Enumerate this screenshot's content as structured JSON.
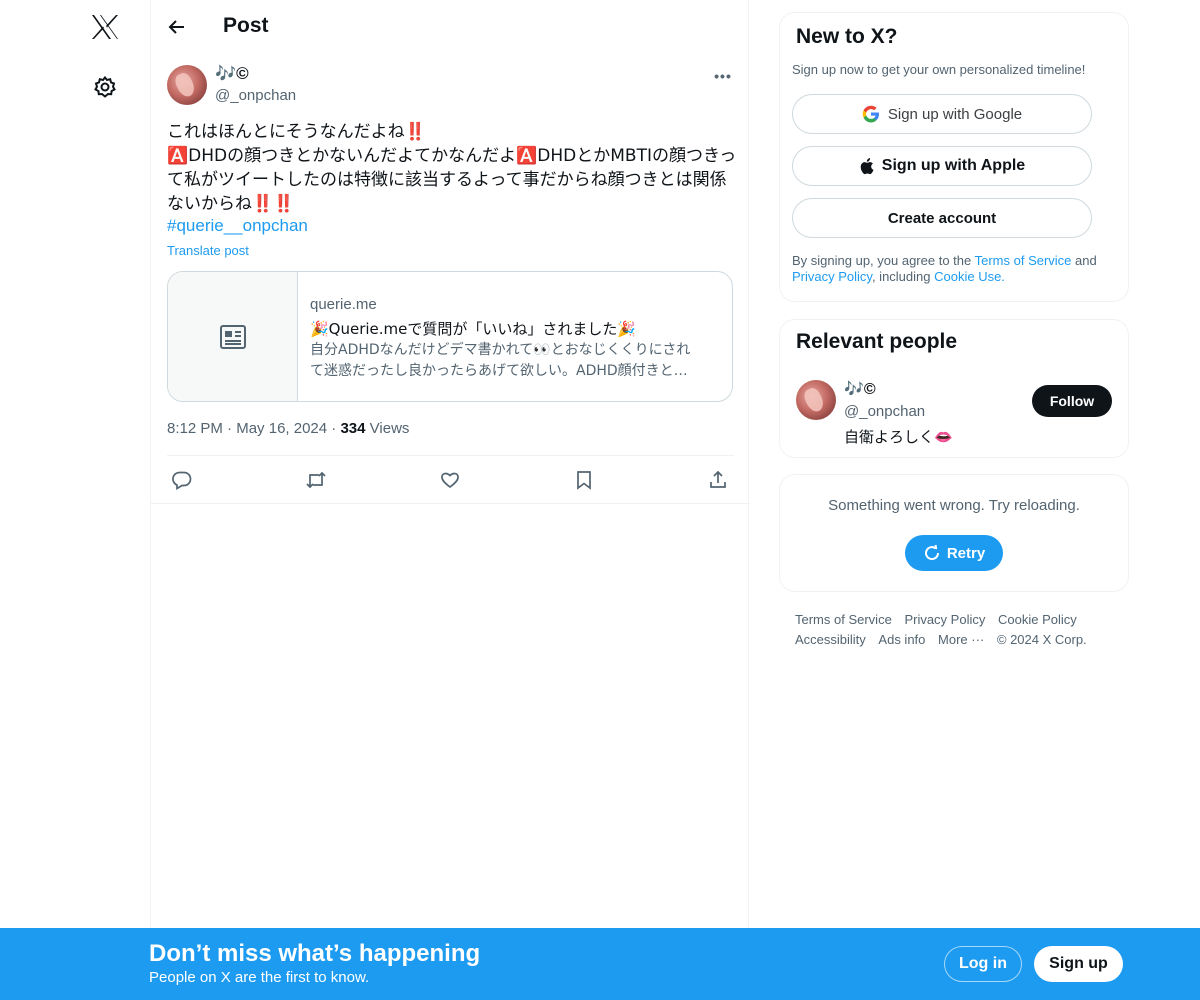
{
  "nav": {
    "logo_icon": "x-logo-icon",
    "settings_icon": "gear-icon"
  },
  "header": {
    "title": "Post",
    "back_icon": "arrow-left-icon"
  },
  "post": {
    "author_name": "🎶©",
    "author_handle": "@_onpchan",
    "text_lines": [
      "これはほんとにそうなんだよね‼️",
      "🅰️DHDの顔つきとかないんだよてかなんだよ🅰️DHDとかMBTIの顔つきっ",
      "て私がツイートしたのは特徴に該当するよって事だからね顔つきとは関係",
      "ないからね‼️‼️"
    ],
    "hashtag": "#querie__onpchan",
    "translate": "Translate post",
    "card": {
      "domain": "querie.me",
      "title": "🎉Querie.meで質問が「いいね」されました🎉",
      "desc_line1": "自分ADHDなんだけどデマ書かれて👀とおなじくくりにされ",
      "desc_line2": "て迷惑だったし良かったらあげて欲しい。ADHD顔付きと…"
    },
    "time": "8:12 PM",
    "date": "May 16, 2024",
    "views_count": "334",
    "views_label": "Views",
    "actions": [
      "reply-icon",
      "repost-icon",
      "like-icon",
      "bookmark-icon",
      "share-icon"
    ]
  },
  "signup_box": {
    "title": "New to X?",
    "subtitle": "Sign up now to get your own personalized timeline!",
    "google": "Sign up with Google",
    "apple": "Sign up with Apple",
    "create": "Create account",
    "legal_prefix": "By signing up, you agree to the ",
    "terms": "Terms of Service",
    "and": " and",
    "privacy": "Privacy Policy",
    "including": ", including ",
    "cookie": "Cookie Use."
  },
  "relevant": {
    "title": "Relevant people",
    "name": "🎶©",
    "handle": "@_onpchan",
    "bio": "自衛よろしく👄",
    "follow": "Follow"
  },
  "error_box": {
    "message": "Something went wrong. Try reloading.",
    "retry": "Retry"
  },
  "footer": {
    "links": [
      "Terms of Service",
      "Privacy Policy",
      "Cookie Policy",
      "Accessibility",
      "Ads info",
      "More ···",
      "© 2024 X Corp."
    ]
  },
  "banner": {
    "title": "Don’t miss what’s happening",
    "subtitle": "People on X are the first to know.",
    "login": "Log in",
    "signup": "Sign up"
  }
}
